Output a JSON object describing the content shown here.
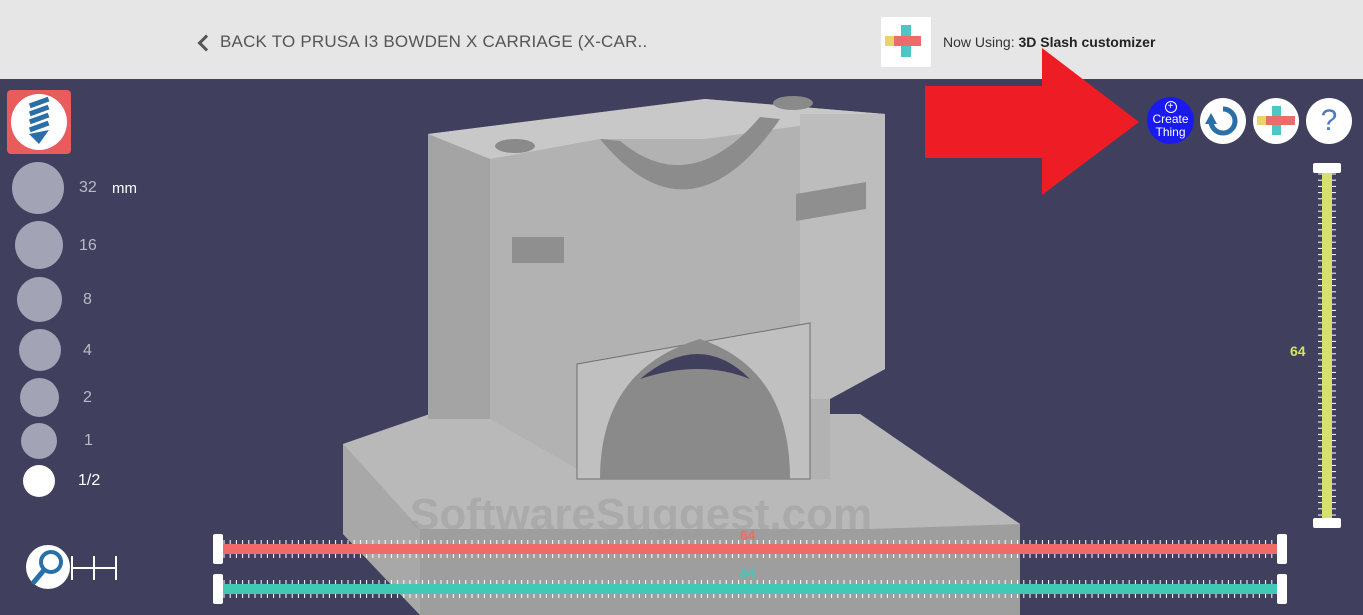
{
  "header": {
    "back_label": "BACK TO PRUSA I3 BOWDEN X CARRIAGE (X-CAR..",
    "now_using_prefix": "Now Using: ",
    "now_using_name": "3D Slash customizer"
  },
  "toolbar": {
    "brush_sizes": [
      {
        "label": "32"
      },
      {
        "label": "16"
      },
      {
        "label": "8"
      },
      {
        "label": "4"
      },
      {
        "label": "2"
      },
      {
        "label": "1"
      },
      {
        "label": "1/2"
      }
    ],
    "unit": "mm"
  },
  "top_right": {
    "create_label_1": "Create",
    "create_label_2": "Thing",
    "help_glyph": "?"
  },
  "sliders": {
    "x_value": "64",
    "y_value": "64",
    "z_value": "64",
    "x_color": "#f06a6a",
    "y_color": "#40c9b5",
    "z_color": "#d6e06a"
  },
  "watermark": "SoftwareSuggest.com",
  "colors": {
    "background": "#40405e",
    "header": "#e6e6e6",
    "arrow": "#ee1c24",
    "create_button": "#1a1aee"
  }
}
